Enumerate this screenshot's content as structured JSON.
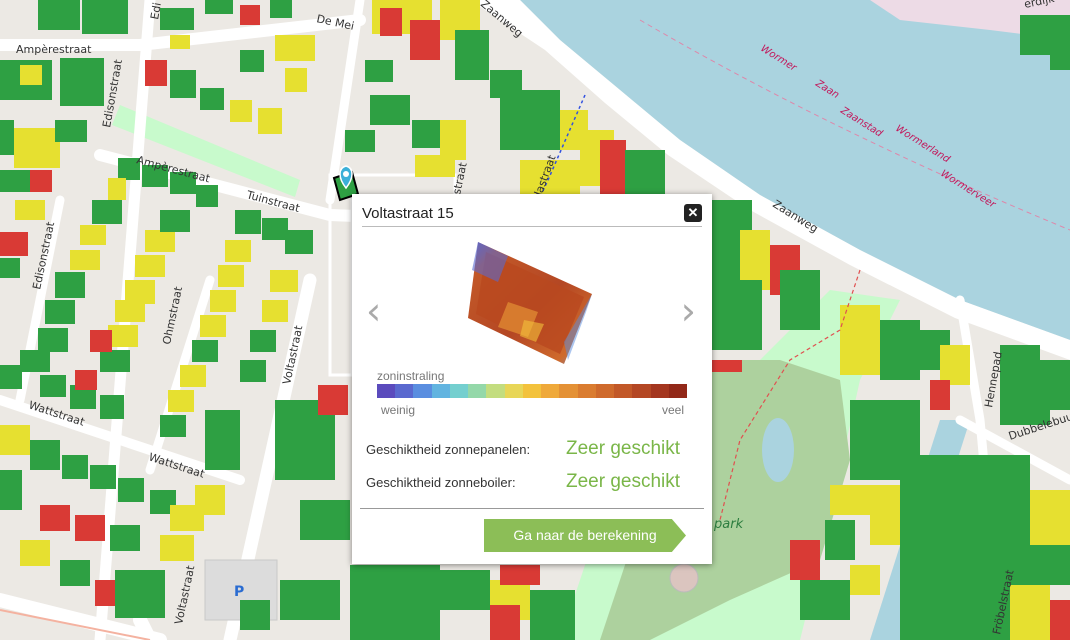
{
  "map": {
    "streets": {
      "amperestraat_top": "Ampèrestraat",
      "amperestraat_mid": "Ampèrestraat",
      "edisonstraat_top": "Edisonstraat",
      "edisonstraat_left": "Edisonstraat",
      "edi": "Edi",
      "de_mei": "De Mei",
      "tuinstraat": "Tuinstraat",
      "ohmstraat": "Ohmstraat",
      "voltastraat_mid": "Voltastraat",
      "voltastraat_bottom": "Voltastraat",
      "wattstraat_left": "Wattstraat",
      "wattstraat_mid": "Wattstraat",
      "zaanweg_top": "Zaanweg",
      "zaanweg_right": "Zaanweg",
      "dastraat": "dastraat",
      "gastraat": "straat",
      "hennepad": "Hennepad",
      "dubbelebuurt": "Dubbelebuurt",
      "frobelstraat": "Fröbelstraat",
      "dijk": "erdijk",
      "park": "park",
      "parking": "P"
    },
    "water": {
      "wormer": "Wormer",
      "zaan": "Zaan",
      "zaanstad": "Zaanstad",
      "wormerland": "Wormerland",
      "wormerveer": "Wormerveer"
    },
    "roof_colors": {
      "very_suitable": "#2ea043",
      "suitable": "#e6e030",
      "unsuitable": "#d93a35"
    }
  },
  "popup": {
    "title": "Voltastraat 15",
    "close_glyph": "✕",
    "prev_glyph": "‹",
    "next_glyph": "›",
    "scale": {
      "title": "zoninstraling",
      "low": "weinig",
      "high": "veel",
      "colors": [
        "#5b4bbd",
        "#5a69cf",
        "#5a8ee0",
        "#62b4e0",
        "#74cfcf",
        "#94d8a9",
        "#c3dd7f",
        "#e8d657",
        "#f3c23c",
        "#efa93a",
        "#e49135",
        "#da7c30",
        "#cf6a2c",
        "#c25828",
        "#b44724",
        "#a4361f",
        "#922818"
      ]
    },
    "rows": [
      {
        "label": "Geschiktheid zonnepanelen:",
        "value": "Zeer geschikt"
      },
      {
        "label": "Geschiktheid zonneboiler:",
        "value": "Zeer geschikt"
      }
    ],
    "cta_label": "Ga naar de berekening"
  }
}
